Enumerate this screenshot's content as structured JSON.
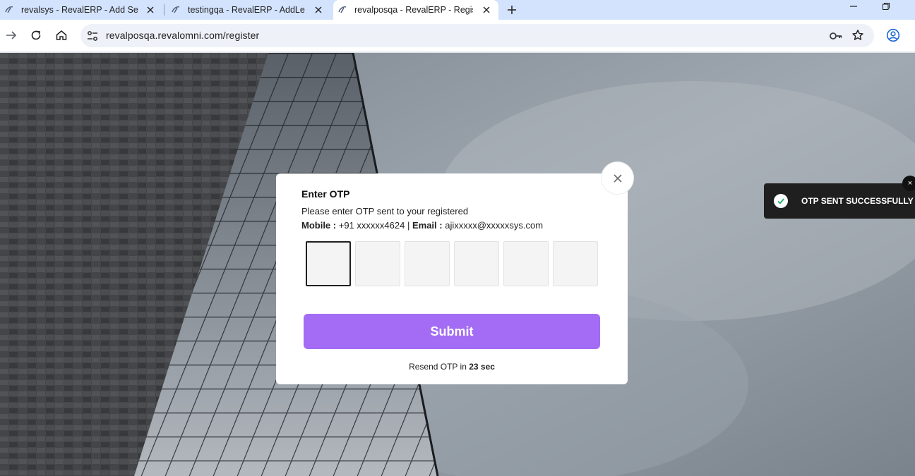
{
  "browser": {
    "tabs": [
      {
        "title": "revalsys - RevalERP - Add Searc",
        "active": false
      },
      {
        "title": "testingqa - RevalERP - AddLeav",
        "active": false
      },
      {
        "title": "revalposqa - RevalERP - Registe",
        "active": true
      }
    ],
    "url": "revalposqa.revalomni.com/register"
  },
  "modal": {
    "title": "Enter OTP",
    "instruction": "Please enter OTP sent to your registered",
    "mobile_label": "Mobile :",
    "mobile_value": "+91 xxxxxx4624",
    "separator": "|",
    "email_label": "Email :",
    "email_value": "ajixxxxx@xxxxxsys.com",
    "otp_digits": [
      "",
      "",
      "",
      "",
      "",
      ""
    ],
    "submit_label": "Submit",
    "resend_prefix": "Resend OTP in",
    "resend_countdown": "23 sec",
    "close_symbol": "×"
  },
  "toast": {
    "message": "OTP SENT SUCCESSFULLY",
    "close_symbol": "×"
  },
  "colors": {
    "submit": "#a46cf4",
    "toast_bg": "#1f1f1f",
    "check": "#2bb57a"
  }
}
